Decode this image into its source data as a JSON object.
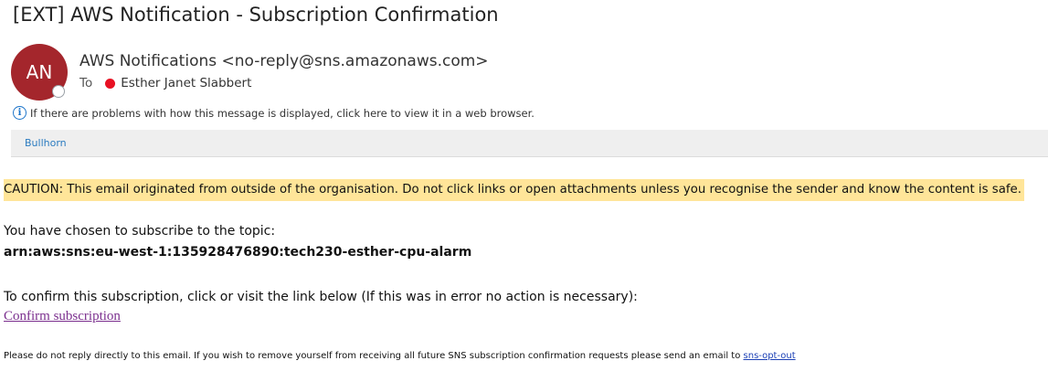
{
  "email": {
    "subject": "[EXT] AWS Notification - Subscription Confirmation",
    "avatar_initials": "AN",
    "from": "AWS Notifications <no-reply@sns.amazonaws.com>",
    "to_label": "To",
    "to_name": "Esther Janet Slabbert",
    "info_message": "If there are problems with how this message is displayed, click here to view it in a web browser.",
    "category": "Bullhorn"
  },
  "body": {
    "caution": "CAUTION: This email originated from outside of the organisation. Do not click links or open attachments unless you recognise the sender and know the content is safe.",
    "intro": "You have chosen to subscribe to the topic:",
    "topic_arn": "arn:aws:sns:eu-west-1:135928476890:tech230-esther-cpu-alarm",
    "confirm_instruction": "To confirm this subscription, click or visit the link below (If this was in error no action is necessary):",
    "confirm_link": "Confirm subscription",
    "footer_text": "Please do not reply directly to this email. If you wish to remove yourself from receiving all future SNS subscription confirmation requests please send an email to ",
    "footer_link": "sns-opt-out"
  },
  "colors": {
    "avatar": "#a4262c",
    "caution_highlight": "#ffe599",
    "link_visited": "#7b2f8e",
    "link": "#1a3fb5",
    "presence_red": "#e81123"
  }
}
